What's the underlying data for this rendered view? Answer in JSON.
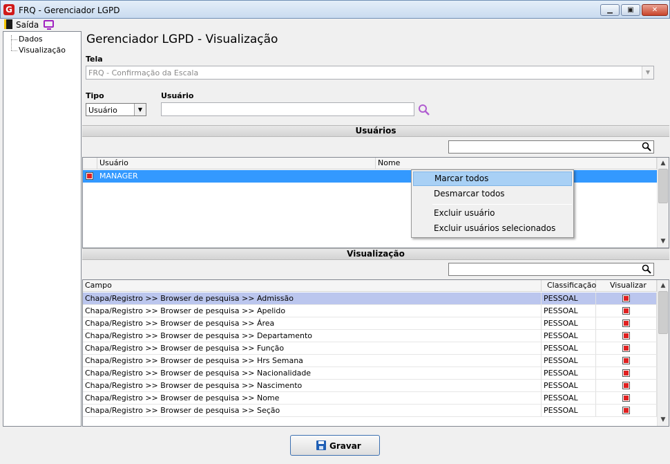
{
  "window": {
    "title": "FRQ - Gerenciador LGPD",
    "app_icon": "G"
  },
  "toolbar": {
    "exit_label": "Saída"
  },
  "tree": {
    "items": [
      "Dados",
      "Visualização"
    ]
  },
  "page": {
    "title": "Gerenciador LGPD - Visualização",
    "tela_label": "Tela",
    "tela_value": "FRQ - Confirmação da Escala",
    "tipo_label": "Tipo",
    "tipo_value": "Usuário",
    "usuario_label": "Usuário",
    "usuario_value": ""
  },
  "usuarios_section": {
    "title": "Usuários",
    "columns": [
      "Usuário",
      "Nome"
    ],
    "rows": [
      {
        "checked": true,
        "usuario": "MANAGER",
        "nome": ""
      }
    ]
  },
  "context_menu": {
    "items": [
      "Marcar todos",
      "Desmarcar todos",
      "Excluir usuário",
      "Excluir usuários selecionados"
    ]
  },
  "visualizacao_section": {
    "title": "Visualização",
    "columns": [
      "Campo",
      "Classificação",
      "Visualizar"
    ],
    "rows": [
      {
        "campo": "Chapa/Registro >> Browser de pesquisa >> Admissão",
        "classificacao": "PESSOAL",
        "visualizar": true
      },
      {
        "campo": "Chapa/Registro >> Browser de pesquisa >> Apelido",
        "classificacao": "PESSOAL",
        "visualizar": true
      },
      {
        "campo": "Chapa/Registro >> Browser de pesquisa >> Área",
        "classificacao": "PESSOAL",
        "visualizar": true
      },
      {
        "campo": "Chapa/Registro >> Browser de pesquisa >> Departamento",
        "classificacao": "PESSOAL",
        "visualizar": true
      },
      {
        "campo": "Chapa/Registro >> Browser de pesquisa >> Função",
        "classificacao": "PESSOAL",
        "visualizar": true
      },
      {
        "campo": "Chapa/Registro >> Browser de pesquisa >> Hrs Semana",
        "classificacao": "PESSOAL",
        "visualizar": true
      },
      {
        "campo": "Chapa/Registro >> Browser de pesquisa >> Nacionalidade",
        "classificacao": "PESSOAL",
        "visualizar": true
      },
      {
        "campo": "Chapa/Registro >> Browser de pesquisa >> Nascimento",
        "classificacao": "PESSOAL",
        "visualizar": true
      },
      {
        "campo": "Chapa/Registro >> Browser de pesquisa >> Nome",
        "classificacao": "PESSOAL",
        "visualizar": true
      },
      {
        "campo": "Chapa/Registro >> Browser de pesquisa >> Seção",
        "classificacao": "PESSOAL",
        "visualizar": true
      }
    ]
  },
  "footer": {
    "save_label": "Gravar"
  },
  "colors": {
    "selection": "#3399ff",
    "row_highlight": "#bbc6ee",
    "menu_hover": "#a8d0f5",
    "check": "#e02020"
  }
}
